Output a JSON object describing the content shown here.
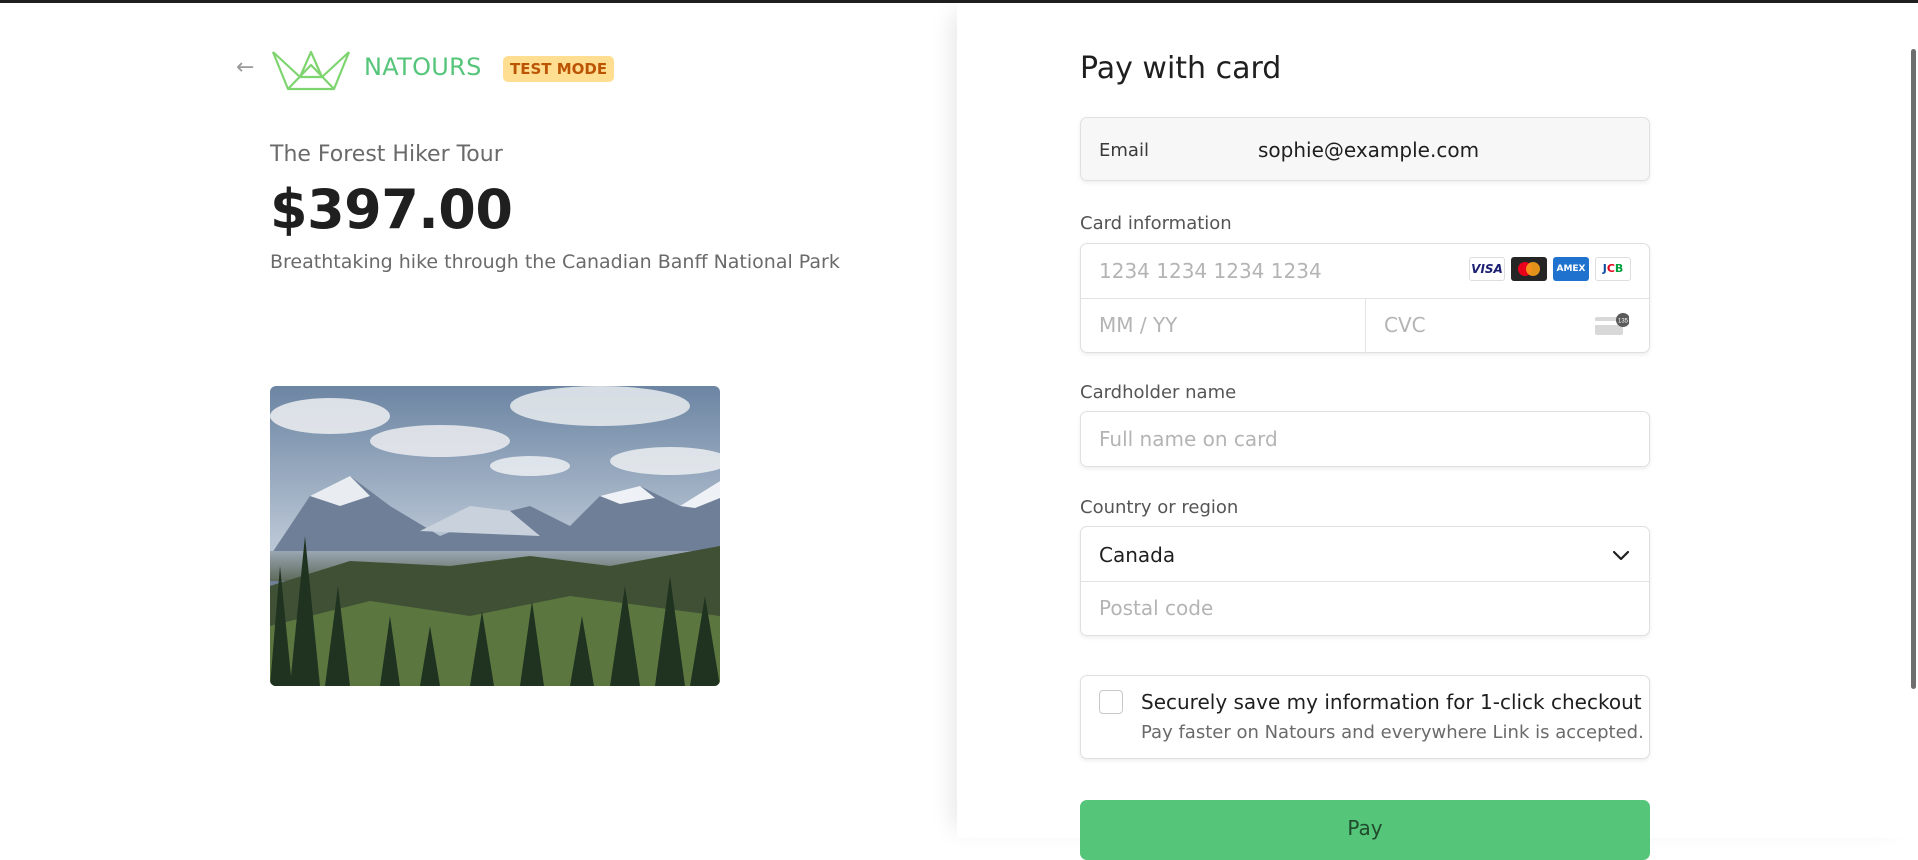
{
  "merchant": {
    "back_icon": "arrow-left-icon",
    "logo_icon": "crown-logo-icon",
    "name": "NATOURS",
    "badge": "TEST MODE",
    "brand_color": "#55c57a",
    "badge_bg": "#ffde92",
    "badge_text_color": "#bb5504"
  },
  "product": {
    "name": "The Forest Hiker Tour",
    "price": "$397.00",
    "description": "Breathtaking hike through the Canadian Banff National Park"
  },
  "checkout": {
    "title": "Pay with card",
    "email_label": "Email",
    "email_value": "sophie@example.com",
    "card_label": "Card information",
    "card_number_placeholder": "1234 1234 1234 1234",
    "card_brands": [
      "VISA",
      "Mastercard",
      "AMEX",
      "JCB"
    ],
    "expiry_placeholder": "MM / YY",
    "cvc_placeholder": "CVC",
    "cvc_icon": "card-back-icon",
    "cvc_badge": "135",
    "cardholder_label": "Cardholder name",
    "cardholder_placeholder": "Full name on card",
    "country_label": "Country or region",
    "country_value": "Canada",
    "postal_placeholder": "Postal code",
    "save_title": "Securely save my information for 1-click checkout",
    "save_subtitle": "Pay faster on Natours and everywhere Link is accepted.",
    "save_checked": false,
    "pay_label": "Pay",
    "pay_color": "#55c57a"
  }
}
